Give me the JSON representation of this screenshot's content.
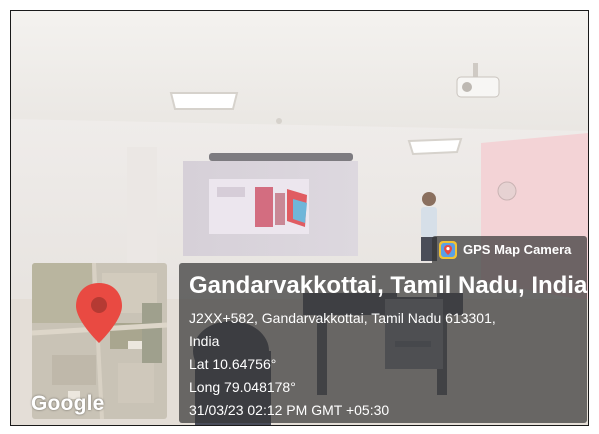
{
  "badge": {
    "label": "GPS Map Camera",
    "icon": "gps-map-camera-icon"
  },
  "location": {
    "title": "Gandarvakkottai, Tamil Nadu, India",
    "address_line1": "J2XX+582, Gandarvakkottai, Tamil Nadu 613301,",
    "address_line2": "India",
    "lat": "Lat 10.64756°",
    "long": "Long 79.048178°",
    "datetime": "31/03/23 02:12 PM GMT +05:30"
  },
  "map": {
    "watermark": "Google",
    "pin_color": "#e94a42"
  }
}
